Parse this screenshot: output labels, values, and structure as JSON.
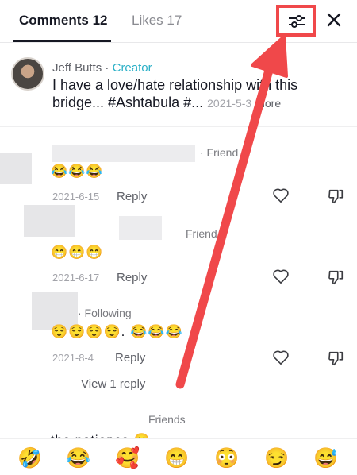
{
  "tabs": {
    "comments_label": "Comments 12",
    "likes_label": "Likes 17"
  },
  "header": {
    "filter_icon": "sliders-icon",
    "close_icon": "close-icon"
  },
  "post": {
    "author": "Jeff Butts",
    "separator": " · ",
    "badge": "Creator",
    "text": "I have a love/hate relationship with this bridge... #Ashtabula #...",
    "date": "2021-5-3",
    "more_label": "more"
  },
  "comments": [
    {
      "meta": "· Friend",
      "emojis": "😂😂😂",
      "date": "2021-6-15",
      "reply_label": "Reply"
    },
    {
      "meta": "Friend",
      "emojis": "😁😁😁",
      "date": "2021-6-17",
      "reply_label": "Reply"
    },
    {
      "meta": "· Following",
      "emojis": "😌😌😌😌. 😂😂😂",
      "date": "2021-8-4",
      "reply_label": "Reply",
      "view_replies": "View 1 reply"
    },
    {
      "meta": "Friends",
      "text": "the patience 😊"
    }
  ],
  "emoji_bar": [
    "🤣",
    "😂",
    "🥰",
    "😁",
    "😳",
    "😏",
    "😅"
  ],
  "colors": {
    "annotation_red": "#f0484a",
    "creator_teal": "#2ab0c7"
  }
}
